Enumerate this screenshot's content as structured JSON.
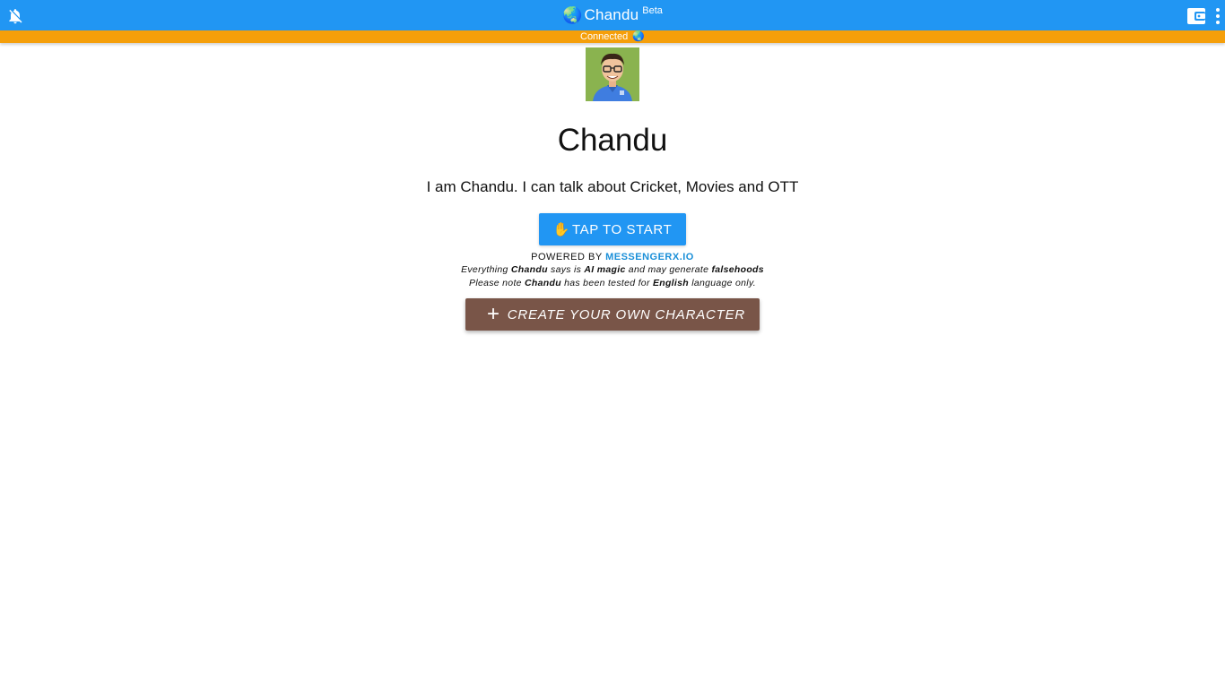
{
  "appbar": {
    "title": "Chandu",
    "badge": "Beta",
    "title_icon": "globe-icon",
    "left_icon": "notifications-off-icon",
    "right_icons": [
      "wallet-icon",
      "more-vert-icon"
    ],
    "color": "#2196f3"
  },
  "status": {
    "text": "Connected",
    "icon": "globe-icon",
    "color": "#f59f0a"
  },
  "character": {
    "name": "Chandu",
    "description": "I am Chandu. I can talk about Cricket, Movies and OTT",
    "avatar": "avatar-image"
  },
  "start_button": {
    "icon": "raised-hand-icon",
    "label": "TAP TO START",
    "color": "#2196f3"
  },
  "powered": {
    "prefix": "POWERED BY",
    "brand": "MESSENGERX.IO"
  },
  "disclaimer": {
    "line1": {
      "t1": "Everything ",
      "name": "Chandu",
      "t2": " says is ",
      "ai": "AI magic",
      "t3": " and may generate ",
      "falsehoods": "falsehoods"
    },
    "line2": {
      "t1": "Please note ",
      "name": "Chandu",
      "t2": " has been tested for ",
      "language": "English",
      "t3": " language only."
    }
  },
  "create_button": {
    "icon": "plus-icon",
    "label": "CREATE YOUR OWN CHARACTER",
    "color": "#795548"
  }
}
